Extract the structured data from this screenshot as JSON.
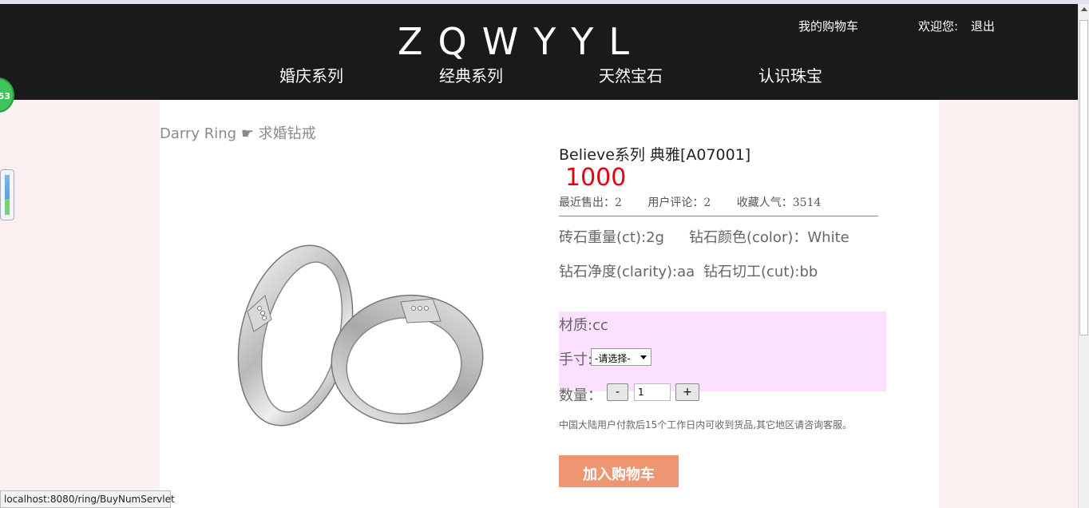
{
  "header": {
    "logo": "ZQWYYL",
    "cart_link": "我的购物车",
    "welcome": "欢迎您:",
    "logout": "退出",
    "nav": [
      "婚庆系列",
      "经典系列",
      "天然宝石",
      "认识珠宝"
    ]
  },
  "breadcrumb": "Darry Ring ☛ 求婚钻戒",
  "product": {
    "title": "Believe系列 典雅[A07001]",
    "price": "1000",
    "stats": {
      "sold": "最近售出：2",
      "reviews": "用户评论：2",
      "favorites": "收藏人气：3514"
    },
    "weight": "砖石重量(ct):2g",
    "color": "钻石颜色(color)：White",
    "clarity": "钻石净度(clarity):aa",
    "cut": "钻石切工(cut):bb",
    "material": "材质:cc",
    "size_label": "手寸:",
    "size_select": "-请选择-",
    "qty_label": "数量：",
    "qty_minus": "-",
    "qty_value": "1",
    "qty_plus": "+",
    "notice": "中国大陆用户付款后15个工作日内可收到货品,其它地区请咨询客服。",
    "add_to_cart": "加入购物车"
  },
  "widgets": {
    "bubble_count": "53"
  },
  "status_bar": "localhost:8080/ring/BuyNumServlet",
  "colors": {
    "header_bg": "#1a1a1a",
    "price": "#e4000f",
    "add_cart_bg": "#ee9572",
    "option_box_bg": "#fce0ff",
    "page_bg": "#fdf0f0"
  }
}
